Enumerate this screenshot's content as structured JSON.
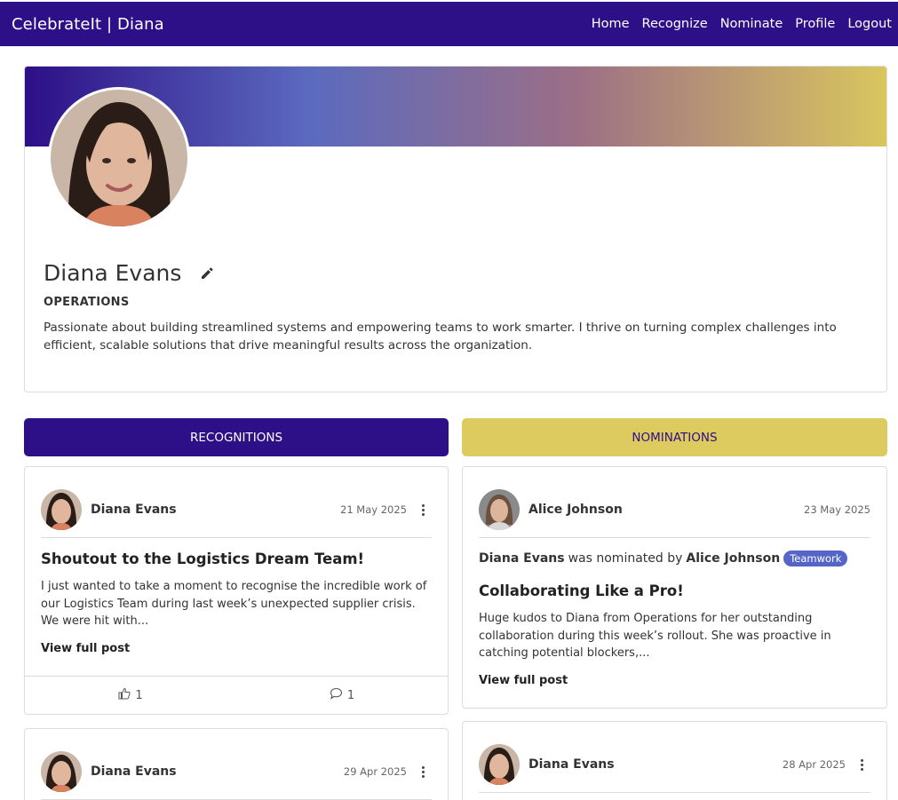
{
  "navbar": {
    "brand": "CelebrateIt | Diana",
    "links": [
      "Home",
      "Recognize",
      "Nominate",
      "Profile",
      "Logout"
    ]
  },
  "profile": {
    "name": "Diana Evans",
    "department": "OPERATIONS",
    "bio": "Passionate about building streamlined systems and empowering teams to work smarter. I thrive on turning complex challenges into efficient, scalable solutions that drive meaningful results across the organization."
  },
  "tabs": {
    "recognitions": "RECOGNITIONS",
    "nominations": "NOMINATIONS"
  },
  "colors": {
    "primary": "#2d0f87",
    "accent": "#decb5f",
    "tag": "#5565c7"
  },
  "recognitions": [
    {
      "author": "Diana Evans",
      "date": "21 May 2025",
      "title": "Shoutout to the Logistics Dream Team!",
      "body": "I just wanted to take a moment to recognise the incredible work of our Logistics Team during last week’s unexpected supplier crisis. We were hit with...",
      "link": "View full post",
      "likes": "1",
      "comments": "1"
    },
    {
      "author": "Diana Evans",
      "date": "29 Apr 2025"
    }
  ],
  "nominations": [
    {
      "author": "Alice Johnson",
      "date": "23 May 2025",
      "nominee": "Diana Evans",
      "nominated_text": "was nominated by",
      "nominator": "Alice Johnson",
      "tag": "Teamwork",
      "title": "Collaborating Like a Pro!",
      "body": "Huge kudos to Diana from Operations for her outstanding collaboration during this week’s rollout. She was proactive in catching potential blockers,...",
      "link": "View full post"
    },
    {
      "author": "Diana Evans",
      "date": "28 Apr 2025"
    }
  ]
}
